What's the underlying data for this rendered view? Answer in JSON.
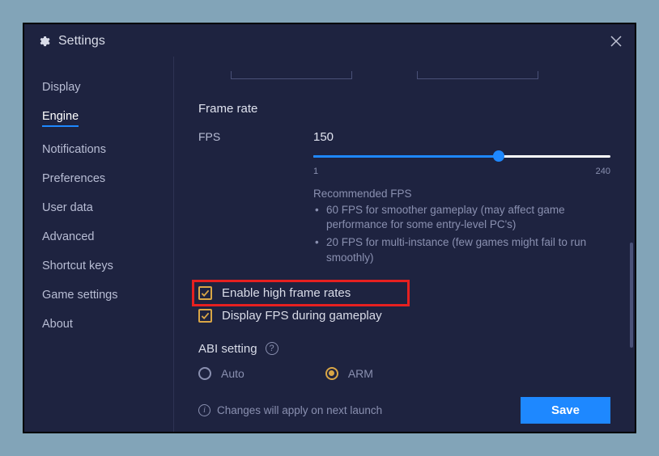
{
  "window": {
    "title": "Settings"
  },
  "sidebar": {
    "items": [
      {
        "label": "Display"
      },
      {
        "label": "Engine"
      },
      {
        "label": "Notifications"
      },
      {
        "label": "Preferences"
      },
      {
        "label": "User data"
      },
      {
        "label": "Advanced"
      },
      {
        "label": "Shortcut keys"
      },
      {
        "label": "Game settings"
      },
      {
        "label": "About"
      }
    ],
    "active_index": 1
  },
  "main": {
    "frame_rate_title": "Frame rate",
    "fps_label": "FPS",
    "fps_value": "150",
    "slider": {
      "min": "1",
      "max": "240",
      "value": 150
    },
    "recommended_title": "Recommended FPS",
    "recommended": [
      "60 FPS for smoother gameplay (may affect game performance for some entry-level PC's)",
      "20 FPS for multi-instance (few games might fail to run smoothly)"
    ],
    "checkboxes": [
      {
        "label": "Enable high frame rates",
        "checked": true,
        "highlight": true
      },
      {
        "label": "Display FPS during gameplay",
        "checked": true,
        "highlight": false
      }
    ],
    "abi_title": "ABI setting",
    "abi_options": [
      {
        "label": "Auto",
        "selected": false
      },
      {
        "label": "ARM",
        "selected": true
      }
    ]
  },
  "footer": {
    "info": "Changes will apply on next launch",
    "save_label": "Save"
  }
}
